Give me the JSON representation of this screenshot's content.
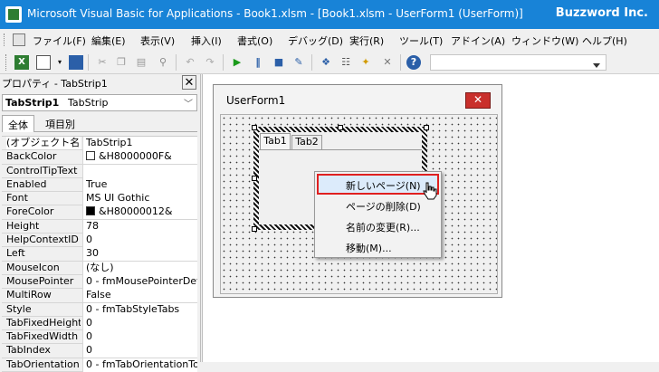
{
  "window": {
    "title": "Microsoft Visual Basic for Applications - Book1.xlsm - [Book1.xlsm - UserForm1 (UserForm)]",
    "brand": "Buzzword Inc."
  },
  "menu": [
    {
      "label": "ファイル(F)"
    },
    {
      "label": "編集(E)"
    },
    {
      "label": "表示(V)"
    },
    {
      "label": "挿入(I)"
    },
    {
      "label": "書式(O)"
    },
    {
      "label": "デバッグ(D)"
    },
    {
      "label": "実行(R)"
    },
    {
      "label": "ツール(T)"
    },
    {
      "label": "アドイン(A)"
    },
    {
      "label": "ウィンドウ(W)"
    },
    {
      "label": "ヘルプ(H)"
    }
  ],
  "toolbar": {
    "icons": [
      "excel-icon",
      "insert-userform-icon",
      "save-icon",
      "cut-icon",
      "copy-icon",
      "paste-icon",
      "find-icon",
      "undo-icon",
      "redo-icon",
      "run-icon",
      "break-icon",
      "reset-icon",
      "design-mode-icon",
      "project-explorer-icon",
      "properties-icon",
      "object-browser-icon",
      "toolbox-icon",
      "help-icon"
    ]
  },
  "properties_panel": {
    "title": "プロパティ - TabStrip1",
    "object_name": "TabStrip1",
    "object_type": "TabStrip",
    "tabs": [
      "全体",
      "項目別"
    ],
    "rows": [
      {
        "name": "(オブジェクト名)",
        "value": "TabStrip1"
      },
      {
        "name": "BackColor",
        "value": "&H8000000F&",
        "swatch": "#ffffff"
      },
      {
        "name": "ControlTipText",
        "value": ""
      },
      {
        "name": "Enabled",
        "value": "True"
      },
      {
        "name": "Font",
        "value": "MS UI Gothic"
      },
      {
        "name": "ForeColor",
        "value": "&H80000012&",
        "swatch": "#000000"
      },
      {
        "name": "Height",
        "value": "78"
      },
      {
        "name": "HelpContextID",
        "value": "0"
      },
      {
        "name": "Left",
        "value": "30"
      },
      {
        "name": "MouseIcon",
        "value": "(なし)"
      },
      {
        "name": "MousePointer",
        "value": "0 - fmMousePointerDef"
      },
      {
        "name": "MultiRow",
        "value": "False"
      },
      {
        "name": "Style",
        "value": "0 - fmTabStyleTabs"
      },
      {
        "name": "TabFixedHeight",
        "value": "0"
      },
      {
        "name": "TabFixedWidth",
        "value": "0"
      },
      {
        "name": "TabIndex",
        "value": "0"
      },
      {
        "name": "TabOrientation",
        "value": "0 - fmTabOrientationTo"
      }
    ]
  },
  "userform": {
    "title": "UserForm1",
    "close_label": "✕",
    "tabstrip_tabs": [
      "Tab1",
      "Tab2"
    ]
  },
  "context_menu": {
    "items": [
      {
        "label": "新しいページ(N)",
        "highlighted": true
      },
      {
        "label": "ページの削除(D)"
      },
      {
        "label": "名前の変更(R)..."
      },
      {
        "label": "移動(M)..."
      }
    ]
  },
  "colors": {
    "titlebar": "#1883d7",
    "highlight_border": "#e02020",
    "close_button": "#c9302c"
  }
}
